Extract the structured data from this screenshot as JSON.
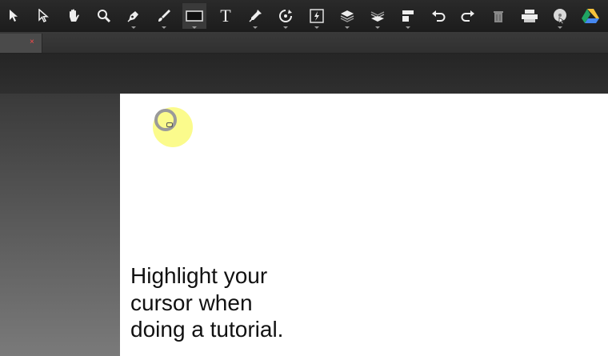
{
  "toolbar": {
    "tools": [
      {
        "name": "pointer-tool",
        "icon": "arrow-icon"
      },
      {
        "name": "direct-select-tool",
        "icon": "hollow-arrow-icon"
      },
      {
        "name": "hand-tool",
        "icon": "hand-icon"
      },
      {
        "name": "zoom-tool",
        "icon": "magnifier-icon"
      },
      {
        "name": "pen-tool",
        "icon": "pen-nib-icon"
      },
      {
        "name": "brush-tool",
        "icon": "brush-icon"
      },
      {
        "name": "rectangle-tool",
        "icon": "rectangle-icon",
        "selected": true
      },
      {
        "name": "text-tool",
        "icon": "text-T-icon"
      },
      {
        "name": "eyedropper-tool",
        "icon": "eyedropper-icon"
      },
      {
        "name": "rotate-tool",
        "icon": "rotate-icon"
      },
      {
        "name": "effects-tool",
        "icon": "lightning-box-icon"
      },
      {
        "name": "bring-forward-tool",
        "icon": "layers-up-icon"
      },
      {
        "name": "send-backward-tool",
        "icon": "layers-down-icon"
      },
      {
        "name": "align-tool",
        "icon": "align-icon"
      },
      {
        "name": "undo-button",
        "icon": "undo-icon"
      },
      {
        "name": "redo-button",
        "icon": "redo-icon"
      },
      {
        "name": "delete-button",
        "icon": "trash-icon"
      },
      {
        "name": "print-button",
        "icon": "printer-icon"
      },
      {
        "name": "save-disc-button",
        "icon": "disc-icon"
      },
      {
        "name": "google-drive-button",
        "icon": "google-drive-icon"
      }
    ],
    "text_tool_glyph": "T"
  },
  "tab": {
    "close_glyph": "×"
  },
  "canvas": {
    "caption_lines": [
      "Highlight your",
      "cursor when",
      "doing a tutorial."
    ],
    "highlight_color": "#fbfb8c"
  }
}
